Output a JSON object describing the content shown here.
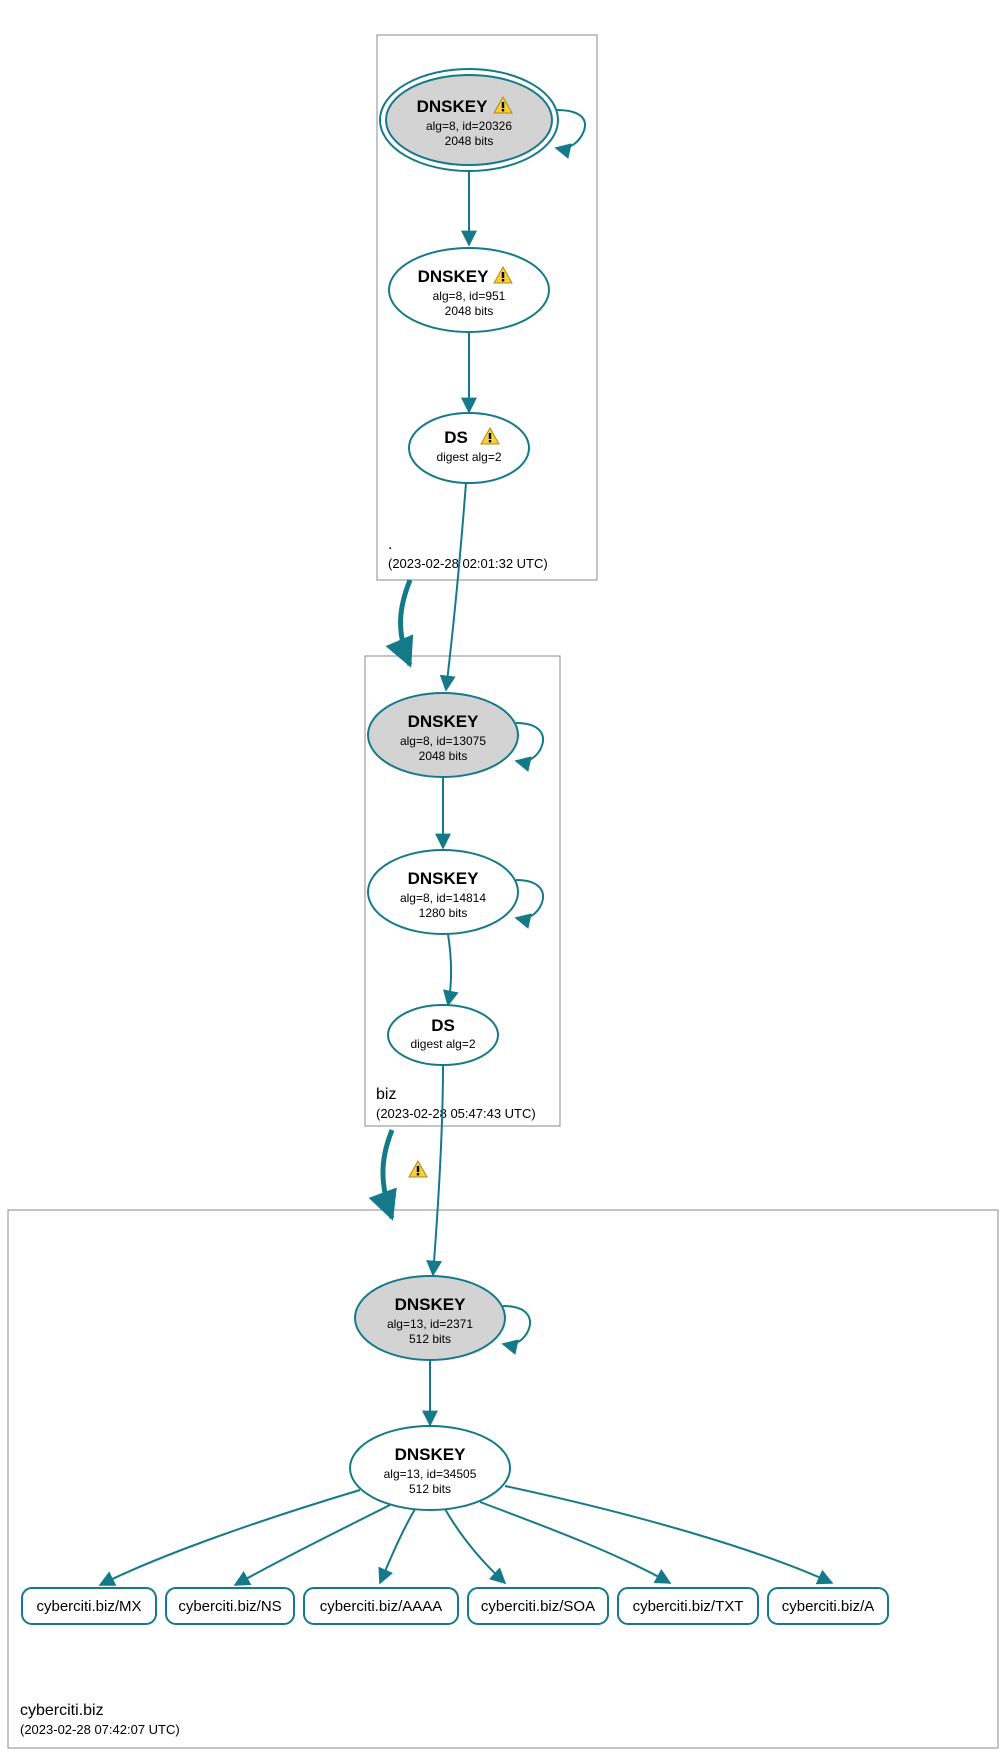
{
  "zones": {
    "root": {
      "name": ".",
      "timestamp": "(2023-02-28 02:01:32 UTC)"
    },
    "biz": {
      "name": "biz",
      "timestamp": "(2023-02-28 05:47:43 UTC)"
    },
    "cyberciti": {
      "name": "cyberciti.biz",
      "timestamp": "(2023-02-28 07:42:07 UTC)"
    }
  },
  "nodes": {
    "root_ksk": {
      "title": "DNSKEY",
      "line1": "alg=8, id=20326",
      "line2": "2048 bits",
      "warn": true
    },
    "root_zsk": {
      "title": "DNSKEY",
      "line1": "alg=8, id=951",
      "line2": "2048 bits",
      "warn": true
    },
    "root_ds": {
      "title": "DS",
      "line1": "digest alg=2",
      "line2": "",
      "warn": true
    },
    "biz_ksk": {
      "title": "DNSKEY",
      "line1": "alg=8, id=13075",
      "line2": "2048 bits",
      "warn": false
    },
    "biz_zsk": {
      "title": "DNSKEY",
      "line1": "alg=8, id=14814",
      "line2": "1280 bits",
      "warn": false
    },
    "biz_ds": {
      "title": "DS",
      "line1": "digest alg=2",
      "line2": "",
      "warn": false
    },
    "cy_ksk": {
      "title": "DNSKEY",
      "line1": "alg=13, id=2371",
      "line2": "512 bits",
      "warn": false
    },
    "cy_zsk": {
      "title": "DNSKEY",
      "line1": "alg=13, id=34505",
      "line2": "512 bits",
      "warn": false
    }
  },
  "rrsets": {
    "mx": "cyberciti.biz/MX",
    "ns": "cyberciti.biz/NS",
    "aaaa": "cyberciti.biz/AAAA",
    "soa": "cyberciti.biz/SOA",
    "txt": "cyberciti.biz/TXT",
    "a": "cyberciti.biz/A"
  },
  "edge_warn": true
}
